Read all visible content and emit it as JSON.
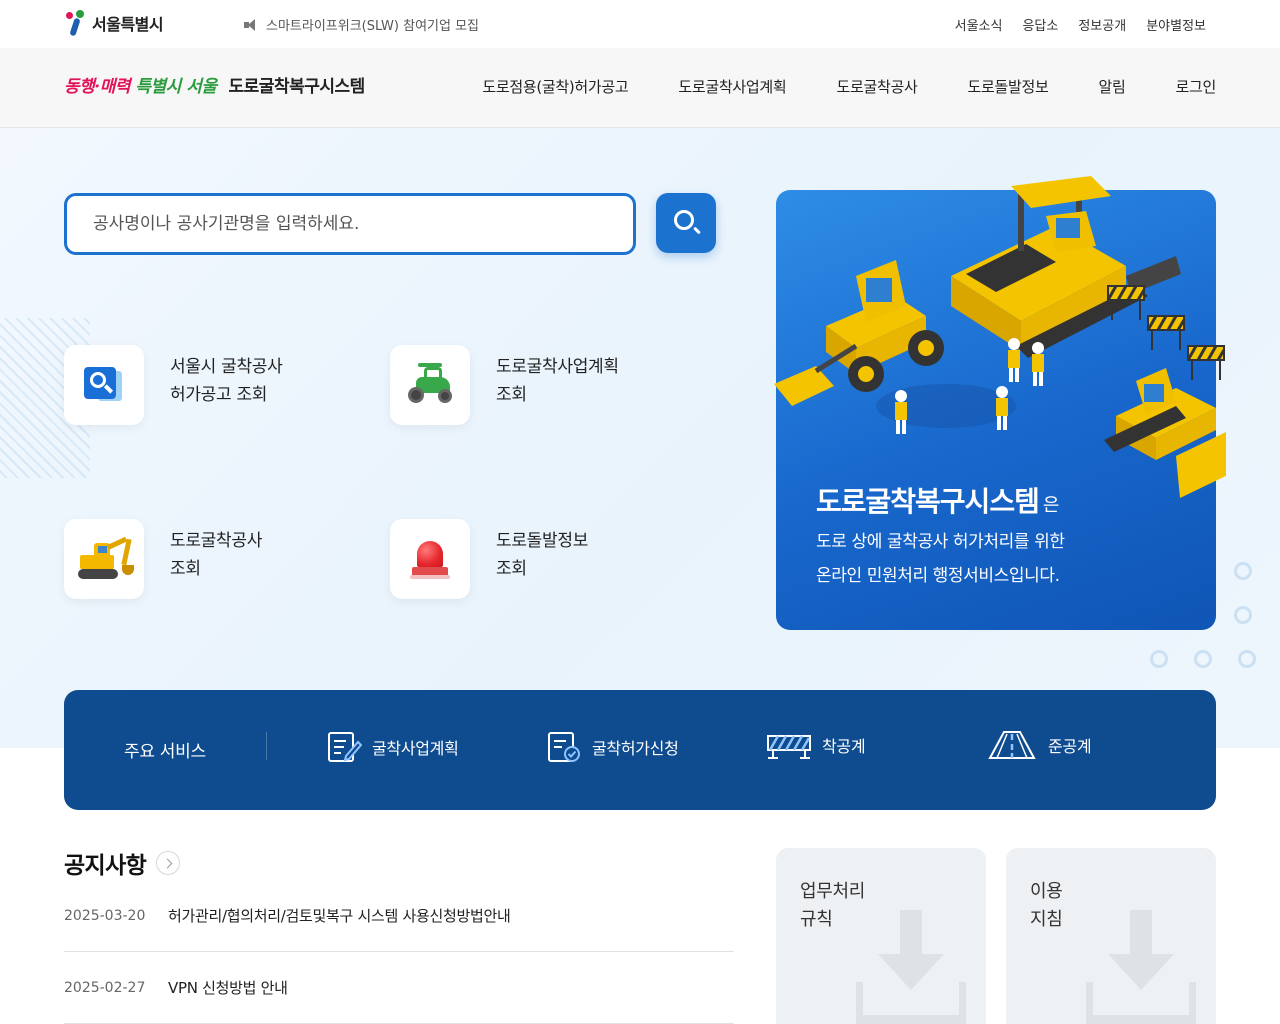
{
  "top": {
    "logo_text": "서울특별시",
    "ticker": "스마트라이프위크(SLW) 참여기업 모집",
    "links": [
      "서울소식",
      "응답소",
      "정보공개",
      "분야별정보"
    ]
  },
  "nav": {
    "slogan_part1": "동행·매력",
    "slogan_part2": "특별시 서울",
    "system_name": "도로굴착복구시스템",
    "menu": [
      "도로점용(굴착)허가공고",
      "도로굴착사업계획",
      "도로굴착공사",
      "도로돌발정보",
      "알림",
      "로그인"
    ]
  },
  "search": {
    "placeholder": "공사명이나 공사기관명을 입력하세요."
  },
  "quick": [
    {
      "line1": "서울시 굴착공사",
      "line2": "허가공고 조회",
      "icon": "search-document-icon"
    },
    {
      "line1": "도로굴착사업계획",
      "line2": "조회",
      "icon": "tractor-icon"
    },
    {
      "line1": "도로굴착공사",
      "line2": "조회",
      "icon": "excavator-icon"
    },
    {
      "line1": "도로돌발정보",
      "line2": "조회",
      "icon": "siren-icon"
    }
  ],
  "promo": {
    "title": "도로굴착복구시스템",
    "title_suffix": "은",
    "desc1": "도로 상에 굴착공사 허가처리를 위한",
    "desc2": "온라인 민원처리 행정서비스입니다."
  },
  "services": {
    "head": "주요 서비스",
    "items": [
      "굴착사업계획",
      "굴착허가신청",
      "착공계",
      "준공계"
    ]
  },
  "notices": {
    "title": "공지사항",
    "items": [
      {
        "date": "2025-03-20",
        "subject": "허가관리/협의처리/검토및복구 시스템 사용신청방법안내"
      },
      {
        "date": "2025-02-27",
        "subject": "VPN 신청방법 안내"
      }
    ]
  },
  "downloads": [
    {
      "line1": "업무처리",
      "line2": "규칙"
    },
    {
      "line1": "이용",
      "line2": "지침"
    }
  ],
  "colors": {
    "primary": "#1c73cf",
    "services_bg": "#0f4b8f",
    "slogan_pink": "#e3135a",
    "slogan_green": "#2b9b3d"
  }
}
